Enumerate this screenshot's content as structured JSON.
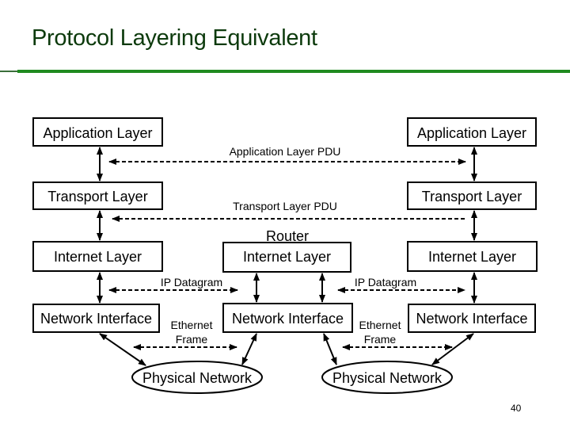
{
  "slide": {
    "title": "Protocol Layering Equivalent",
    "page_number": "40",
    "accent_color": "#1f8a1f",
    "title_color": "#0c3a0c"
  },
  "left_host": {
    "application": "Application Layer",
    "transport": "Transport Layer",
    "internet": "Internet Layer",
    "network_interface": "Network Interface"
  },
  "router": {
    "label": "Router",
    "internet": "Internet Layer",
    "network_interface": "Network Interface"
  },
  "right_host": {
    "application": "Application Layer",
    "transport": "Transport Layer",
    "internet": "Internet Layer",
    "network_interface": "Network Interface"
  },
  "pdus": {
    "application": "Application Layer PDU",
    "transport": "Transport Layer PDU",
    "ip_left": "IP Datagram",
    "ip_right": "IP Datagram",
    "ethernet_left_line1": "Ethernet",
    "ethernet_left_line2": "Frame",
    "ethernet_right_line1": "Ethernet",
    "ethernet_right_line2": "Frame"
  },
  "networks": {
    "left": "Physical Network",
    "right": "Physical Network"
  }
}
